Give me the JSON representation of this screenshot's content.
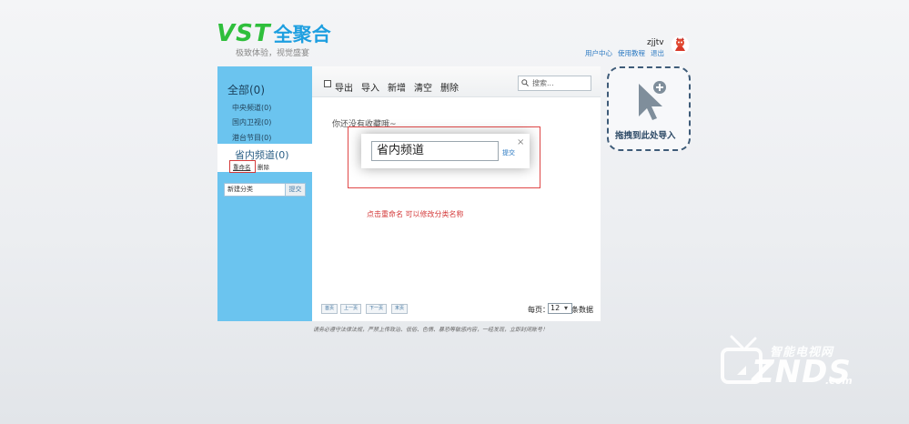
{
  "header": {
    "logo_latin": "VST",
    "logo_cjk": "全聚合",
    "slogan": "极致体验，视觉盛宴",
    "username": "zjjtv",
    "links": [
      "用户中心",
      "使用教程",
      "退出"
    ]
  },
  "sidebar": {
    "all_label": "全部(0)",
    "items": [
      {
        "label": "中央频道(0)"
      },
      {
        "label": "国内卫视(0)"
      },
      {
        "label": "港台节目(0)"
      }
    ],
    "active_label": "省内频道(0)",
    "rename_label": "重命名",
    "delete_label": "删除",
    "new_category_value": "新建分类",
    "submit_label": "提交"
  },
  "toolbar": {
    "items": [
      "导出",
      "导入",
      "新增",
      "清空",
      "删除"
    ],
    "search_placeholder": "搜索..."
  },
  "main": {
    "empty_message": "你还没有收藏哦~",
    "hint": "点击重命名 可以修改分类名称"
  },
  "dialog": {
    "input_value": "省内频道",
    "submit_label": "提交",
    "close_glyph": "×"
  },
  "pagination": {
    "buttons": [
      "首页",
      "上一页",
      "下一页",
      "末页"
    ],
    "per_page_label": "每页：",
    "per_page_value": "12",
    "per_page_suffix": "条数据"
  },
  "footer_note": "请务必遵守法律法规，严禁上传政治、低俗、色情、暴恐等敏感内容，一经发现，立即封闭账号！",
  "dropzone": {
    "label": "拖拽到此处导入"
  },
  "watermark": {
    "cn": "智能电视网",
    "latin": "ZNDS",
    "suffix": ".com"
  },
  "colors": {
    "sidebar_bg": "#6bc4ef",
    "logo_green": "#2fbf3c",
    "logo_blue": "#1e9fe0",
    "highlight_red": "#d43a3a",
    "link_blue": "#2b79c2"
  }
}
